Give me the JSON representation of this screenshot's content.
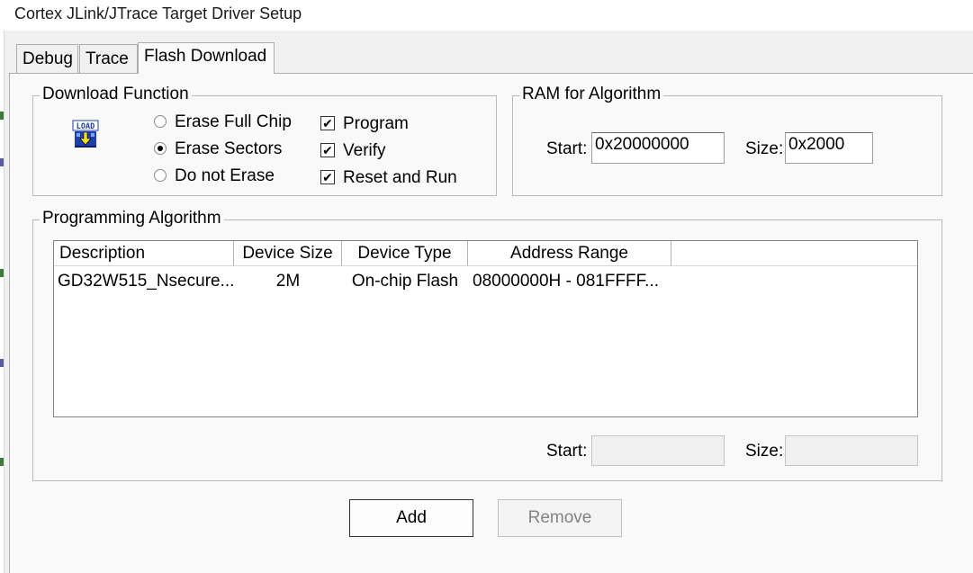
{
  "window": {
    "title": "Cortex JLink/JTrace Target Driver Setup"
  },
  "tabs": [
    {
      "label": "Debug",
      "active": false
    },
    {
      "label": "Trace",
      "active": false
    },
    {
      "label": "Flash Download",
      "active": true
    }
  ],
  "download_function": {
    "legend": "Download Function",
    "icon": "load-icon",
    "icon_text": "LOAD",
    "erase_options": [
      {
        "label": "Erase Full Chip",
        "selected": false
      },
      {
        "label": "Erase Sectors",
        "selected": true
      },
      {
        "label": "Do not Erase",
        "selected": false
      }
    ],
    "checkboxes": [
      {
        "label": "Program",
        "checked": true,
        "mark": "✔"
      },
      {
        "label": "Verify",
        "checked": true,
        "mark": "✔"
      },
      {
        "label": "Reset and Run",
        "checked": true,
        "mark": "✔"
      }
    ]
  },
  "ram_for_algorithm": {
    "legend": "RAM for Algorithm",
    "start_label": "Start:",
    "start_value": "0x20000000",
    "size_label": "Size:",
    "size_value": "0x2000"
  },
  "programming_algorithm": {
    "legend": "Programming Algorithm",
    "columns": [
      "Description",
      "Device Size",
      "Device Type",
      "Address Range"
    ],
    "rows": [
      {
        "description": "GD32W515_Nsecure...",
        "device_size": "2M",
        "device_type": "On-chip Flash",
        "address_range": "08000000H - 081FFFF..."
      }
    ],
    "start_label": "Start:",
    "start_value": "",
    "size_label": "Size:",
    "size_value": ""
  },
  "buttons": {
    "add": "Add",
    "remove": "Remove"
  },
  "colors": {
    "window_bg": "#f0f0f0",
    "panel_bg": "#f9f9f9",
    "disabled_text": "#838383",
    "icon_blue": "#1f3fa8",
    "icon_yellow": "#f3e21d"
  }
}
